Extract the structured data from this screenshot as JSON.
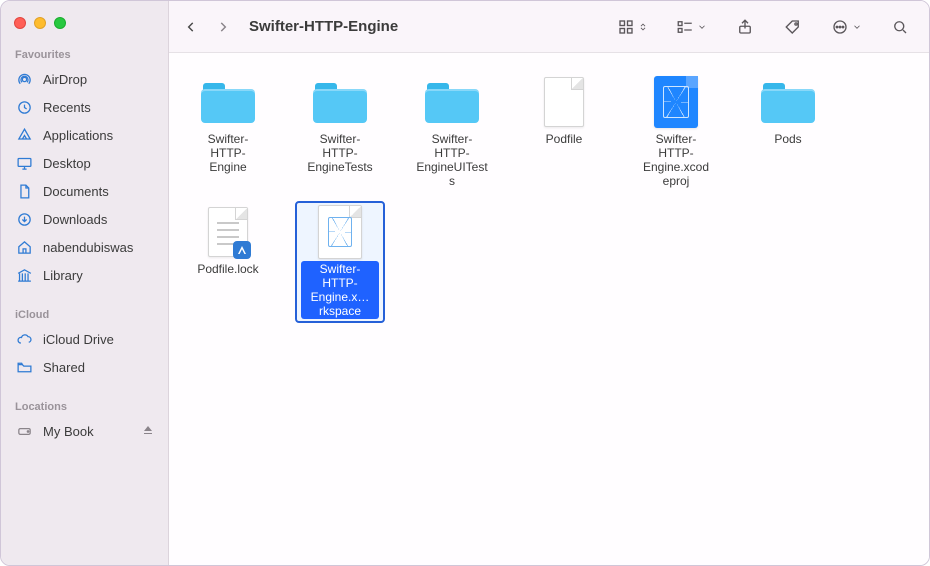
{
  "window_title": "Swifter-HTTP-Engine",
  "sidebar": {
    "sections": [
      {
        "title": "Favourites",
        "items": [
          {
            "icon": "airdrop",
            "label": "AirDrop"
          },
          {
            "icon": "clock",
            "label": "Recents"
          },
          {
            "icon": "apps",
            "label": "Applications"
          },
          {
            "icon": "desktop",
            "label": "Desktop"
          },
          {
            "icon": "doc",
            "label": "Documents"
          },
          {
            "icon": "download",
            "label": "Downloads"
          },
          {
            "icon": "home",
            "label": "nabendubiswas"
          },
          {
            "icon": "library",
            "label": "Library"
          }
        ]
      },
      {
        "title": "iCloud",
        "items": [
          {
            "icon": "cloud",
            "label": "iCloud Drive"
          },
          {
            "icon": "shared",
            "label": "Shared"
          }
        ]
      },
      {
        "title": "Locations",
        "items": [
          {
            "icon": "disk",
            "label": "My Book",
            "eject": true
          }
        ]
      }
    ]
  },
  "files": [
    {
      "kind": "folder",
      "label": "Swifter-HTTP-Engine"
    },
    {
      "kind": "folder",
      "label": "Swifter-HTTP-EngineTests"
    },
    {
      "kind": "folder",
      "label": "Swifter-HTTP-EngineUITests"
    },
    {
      "kind": "file",
      "label": "Podfile"
    },
    {
      "kind": "xcproj",
      "label": "Swifter-HTTP-Engine.xcodeproj"
    },
    {
      "kind": "folder",
      "label": "Pods"
    },
    {
      "kind": "vslock",
      "label": "Podfile.lock"
    },
    {
      "kind": "xcwork",
      "label": "Swifter-HTTP-Engine.x…rkspace",
      "selected": true
    }
  ]
}
